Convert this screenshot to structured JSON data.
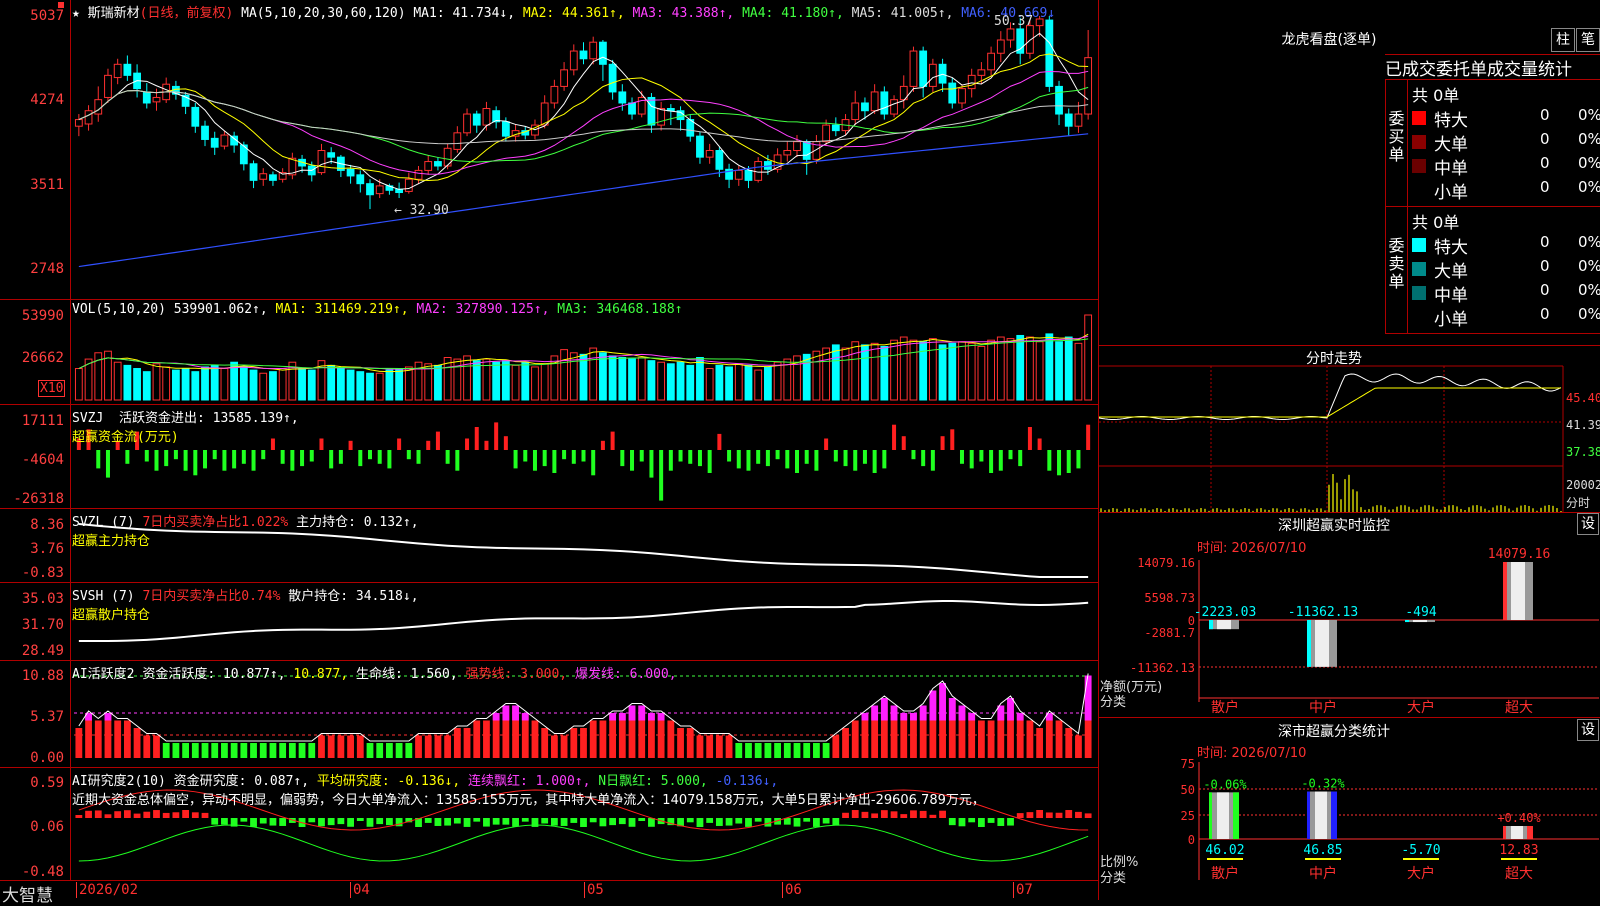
{
  "stock": {
    "name": "斯瑞新材",
    "period_label": "(日线，前复权)"
  },
  "kline": {
    "y_ticks": [
      "5037",
      "4274",
      "3511",
      "2748"
    ],
    "ma_legend": [
      {
        "text": "MA(5,10,20,30,60,120)",
        "color": "#ffffff"
      },
      {
        "text": "MA1: 41.734↓,",
        "color": "#ffffff"
      },
      {
        "text": "MA2: 44.361↑,",
        "color": "#ffff00"
      },
      {
        "text": "MA3: 43.388↑,",
        "color": "#ff40ff"
      },
      {
        "text": "MA4: 41.180↑,",
        "color": "#40ff40"
      },
      {
        "text": "MA5: 41.005↑,",
        "color": "#dddddd"
      },
      {
        "text": "MA6: 40.669↓",
        "color": "#4060ff"
      }
    ],
    "high_label": "50.37",
    "low_label": "32.90",
    "y_range": [
      2748,
      5037
    ],
    "candles": [
      [
        4040,
        4100,
        3950,
        4150
      ],
      [
        4060,
        4180,
        4000,
        4230
      ],
      [
        4150,
        4280,
        4080,
        4400
      ],
      [
        4300,
        4500,
        4250,
        4560
      ],
      [
        4480,
        4600,
        4420,
        4650
      ],
      [
        4600,
        4500,
        4450,
        4680
      ],
      [
        4520,
        4380,
        4300,
        4600
      ],
      [
        4350,
        4250,
        4200,
        4430
      ],
      [
        4260,
        4300,
        4180,
        4380
      ],
      [
        4280,
        4420,
        4250,
        4480
      ],
      [
        4400,
        4330,
        4280,
        4450
      ],
      [
        4320,
        4220,
        4150,
        4350
      ],
      [
        4210,
        4040,
        3980,
        4250
      ],
      [
        4040,
        3920,
        3860,
        4090
      ],
      [
        3930,
        3850,
        3780,
        3990
      ],
      [
        3860,
        3960,
        3830,
        4000
      ],
      [
        3950,
        3870,
        3800,
        3990
      ],
      [
        3870,
        3700,
        3640,
        3900
      ],
      [
        3700,
        3550,
        3480,
        3730
      ],
      [
        3560,
        3610,
        3500,
        3660
      ],
      [
        3600,
        3550,
        3500,
        3630
      ],
      [
        3560,
        3620,
        3530,
        3660
      ],
      [
        3600,
        3750,
        3560,
        3800
      ],
      [
        3740,
        3680,
        3620,
        3780
      ],
      [
        3680,
        3600,
        3540,
        3720
      ],
      [
        3620,
        3820,
        3600,
        3880
      ],
      [
        3800,
        3760,
        3700,
        3850
      ],
      [
        3760,
        3640,
        3580,
        3780
      ],
      [
        3650,
        3590,
        3520,
        3690
      ],
      [
        3600,
        3520,
        3440,
        3640
      ],
      [
        3520,
        3420,
        3290,
        3560
      ],
      [
        3430,
        3500,
        3390,
        3560
      ],
      [
        3500,
        3460,
        3420,
        3520
      ],
      [
        3470,
        3440,
        3390,
        3530
      ],
      [
        3450,
        3560,
        3430,
        3620
      ],
      [
        3560,
        3640,
        3520,
        3680
      ],
      [
        3640,
        3720,
        3600,
        3780
      ],
      [
        3720,
        3680,
        3640,
        3760
      ],
      [
        3680,
        3840,
        3650,
        3880
      ],
      [
        3830,
        3980,
        3800,
        4040
      ],
      [
        3980,
        4150,
        3950,
        4200
      ],
      [
        4150,
        4050,
        3980,
        4180
      ],
      [
        4050,
        4200,
        4000,
        4260
      ],
      [
        4180,
        4080,
        4020,
        4220
      ],
      [
        4080,
        3950,
        3900,
        4120
      ],
      [
        3950,
        4000,
        3900,
        4060
      ],
      [
        4000,
        3960,
        3920,
        4040
      ],
      [
        3960,
        4050,
        3920,
        4100
      ],
      [
        4050,
        4250,
        4020,
        4320
      ],
      [
        4250,
        4400,
        4200,
        4460
      ],
      [
        4400,
        4550,
        4360,
        4620
      ],
      [
        4550,
        4720,
        4500,
        4780
      ],
      [
        4720,
        4650,
        4600,
        4800
      ],
      [
        4650,
        4800,
        4600,
        4850
      ],
      [
        4800,
        4600,
        4450,
        4820
      ],
      [
        4600,
        4350,
        4280,
        4640
      ],
      [
        4350,
        4250,
        4180,
        4420
      ],
      [
        4250,
        4150,
        4100,
        4300
      ],
      [
        4150,
        4300,
        4120,
        4360
      ],
      [
        4300,
        4050,
        3980,
        4340
      ],
      [
        4050,
        4200,
        4000,
        4260
      ],
      [
        4200,
        4180,
        4050,
        4240
      ],
      [
        4180,
        4100,
        4000,
        4220
      ],
      [
        4100,
        3950,
        3900,
        4140
      ],
      [
        3950,
        3760,
        3700,
        3990
      ],
      [
        3760,
        3820,
        3700,
        3880
      ],
      [
        3820,
        3650,
        3580,
        3850
      ],
      [
        3650,
        3560,
        3480,
        3700
      ],
      [
        3560,
        3640,
        3500,
        3680
      ],
      [
        3640,
        3550,
        3480,
        3680
      ],
      [
        3550,
        3720,
        3530,
        3760
      ],
      [
        3720,
        3650,
        3600,
        3780
      ],
      [
        3650,
        3780,
        3620,
        3840
      ],
      [
        3780,
        3820,
        3720,
        3900
      ],
      [
        3820,
        3900,
        3760,
        3960
      ],
      [
        3900,
        3740,
        3600,
        3920
      ],
      [
        3740,
        3900,
        3700,
        3960
      ],
      [
        3900,
        4050,
        3860,
        4100
      ],
      [
        4050,
        4000,
        3950,
        4120
      ],
      [
        4000,
        4100,
        3960,
        4150
      ],
      [
        4100,
        4250,
        4050,
        4360
      ],
      [
        4250,
        4180,
        4100,
        4300
      ],
      [
        4180,
        4350,
        4150,
        4420
      ],
      [
        4350,
        4150,
        4100,
        4400
      ],
      [
        4150,
        4280,
        4120,
        4320
      ],
      [
        4280,
        4400,
        4200,
        4500
      ],
      [
        4400,
        4720,
        4350,
        4760
      ],
      [
        4720,
        4400,
        4300,
        4760
      ],
      [
        4400,
        4600,
        4350,
        4650
      ],
      [
        4600,
        4430,
        4350,
        4650
      ],
      [
        4430,
        4250,
        4200,
        4480
      ],
      [
        4250,
        4380,
        4200,
        4420
      ],
      [
        4380,
        4500,
        4300,
        4560
      ],
      [
        4500,
        4550,
        4420,
        4620
      ],
      [
        4550,
        4700,
        4500,
        4760
      ],
      [
        4700,
        4820,
        4620,
        4900
      ],
      [
        4820,
        4920,
        4750,
        4980
      ],
      [
        4920,
        4700,
        4600,
        5020
      ],
      [
        4700,
        4950,
        4650,
        5000
      ],
      [
        4950,
        5010,
        4850,
        5037
      ],
      [
        5000,
        4400,
        4350,
        5037
      ],
      [
        4400,
        4150,
        4050,
        4450
      ],
      [
        4150,
        4040,
        3950,
        4200
      ],
      [
        4040,
        4150,
        3980,
        4260
      ],
      [
        4150,
        4660,
        4100,
        4910
      ]
    ]
  },
  "volume": {
    "header": "VOL(5,10,20)",
    "items": [
      {
        "text": "539901.062↑,",
        "color": "#ffffff"
      },
      {
        "text": "MA1: 311469.219↑,",
        "color": "#ffff00"
      },
      {
        "text": "MA2: 327890.125↑,",
        "color": "#ff40ff"
      },
      {
        "text": "MA3: 346468.188↑",
        "color": "#40ff40"
      }
    ],
    "y_ticks": [
      "53990",
      "26662"
    ],
    "unit": "X10",
    "values": [
      20,
      26,
      30,
      31,
      24,
      22,
      20,
      18,
      23,
      21,
      19,
      20,
      18,
      21,
      22,
      20,
      24,
      21,
      19,
      17,
      18,
      20,
      24,
      20,
      19,
      25,
      22,
      20,
      19,
      18,
      17,
      17,
      19,
      20,
      21,
      24,
      23,
      22,
      27,
      26,
      28,
      25,
      26,
      24,
      25,
      22,
      24,
      21,
      23,
      28,
      32,
      30,
      29,
      33,
      30,
      28,
      27,
      26,
      27,
      25,
      24,
      23,
      24,
      22,
      27,
      20,
      22,
      21,
      23,
      22,
      19,
      21,
      24,
      26,
      28,
      29,
      31,
      33,
      35,
      33,
      37,
      35,
      36,
      34,
      38,
      40,
      38,
      37,
      39,
      35,
      36,
      37,
      36,
      34,
      38,
      40,
      39,
      41,
      40,
      37,
      42,
      37,
      40,
      36,
      54
    ]
  },
  "svzj": {
    "header": "SVZJ",
    "line1": "活跃资金进出: 13585.139↑,",
    "line2": "超赢资金流(万元)",
    "y_ticks": [
      "17111",
      "-4604",
      "-26318"
    ],
    "values": [
      5,
      9,
      -8,
      -12,
      4,
      -6,
      8,
      -5,
      -9,
      -7,
      -4,
      -9,
      -11,
      -8,
      -4,
      -9,
      -8,
      -6,
      -9,
      -4,
      5,
      -6,
      -9,
      -7,
      -5,
      5,
      -8,
      -6,
      4,
      -7,
      -4,
      -6,
      -8,
      5,
      -4,
      -6,
      4,
      8,
      -6,
      -9,
      5,
      10,
      4,
      12,
      6,
      -8,
      -5,
      -9,
      -7,
      -10,
      -4,
      -6,
      -5,
      -11,
      4,
      8,
      -7,
      -9,
      -5,
      -12,
      -22,
      -9,
      -5,
      -6,
      -7,
      -10,
      7,
      -5,
      -8,
      -9,
      -6,
      -7,
      -4,
      -8,
      -10,
      -6,
      -9,
      5,
      -5,
      -7,
      -9,
      -6,
      -10,
      -8,
      11,
      6,
      -4,
      -7,
      -9,
      6,
      9,
      -6,
      -8,
      -5,
      -10,
      -9,
      -4,
      -7,
      10,
      5,
      -9,
      -11,
      -10,
      -8,
      11
    ]
  },
  "svzl": {
    "header": "SVZL (7)",
    "text1": "7日内买卖净占比1.022%",
    "text2": "主力持仓: 0.132↑,",
    "line2": "超赢主力持仓",
    "y_ticks": [
      "8.36",
      "3.76",
      "-0.83"
    ]
  },
  "svsh": {
    "header": "SVSH (7)",
    "text1": "7日内买卖净占比0.74%",
    "text2": "散户持仓: 34.518↓,",
    "line2": "超赢散户持仓",
    "y_ticks": [
      "35.03",
      "31.70",
      "28.49"
    ]
  },
  "ai_active": {
    "header": "AI活跃度2",
    "items": [
      {
        "text": "资金活跃度: 10.877↑,",
        "color": "#ffffff"
      },
      {
        "text": "10.877,",
        "color": "#ffff00"
      },
      {
        "text": "生命线: 1.560,",
        "color": "#ffffff"
      },
      {
        "text": "强势线: 3.000,",
        "color": "#ff3030"
      },
      {
        "text": "爆发线: 6.000,",
        "color": "#ff40ff"
      }
    ],
    "y_ticks": [
      "10.88",
      "5.37",
      "0.00"
    ],
    "values": [
      4,
      6,
      5,
      6,
      5,
      5,
      4,
      3,
      3,
      2,
      2,
      2,
      2,
      2,
      2,
      2,
      2,
      2,
      2,
      2,
      2,
      2,
      2,
      2,
      2,
      3,
      3,
      3,
      3,
      3,
      2,
      2,
      2,
      2,
      2,
      3,
      3,
      3,
      3,
      4,
      4,
      5,
      5,
      6,
      7,
      7,
      6,
      5,
      4,
      3,
      3,
      4,
      4,
      5,
      5,
      6,
      6,
      7,
      7,
      6,
      6,
      5,
      4,
      4,
      3,
      3,
      3,
      3,
      2,
      2,
      2,
      2,
      2,
      2,
      2,
      2,
      2,
      2,
      3,
      4,
      5,
      6,
      7,
      8,
      7,
      6,
      6,
      7,
      9,
      10,
      8,
      7,
      6,
      5,
      5,
      7,
      8,
      6,
      5,
      4,
      6,
      5,
      4,
      3,
      11
    ]
  },
  "ai_research": {
    "header": "AI研究度2(10)",
    "items": [
      {
        "text": "资金研究度: 0.087↑,",
        "color": "#ffffff"
      },
      {
        "text": "平均研究度: -0.136↓,",
        "color": "#ffff00"
      },
      {
        "text": "连续飘红: 1.000↑,",
        "color": "#ff40ff"
      },
      {
        "text": "N日飘红: 5.000,",
        "color": "#40ff40"
      },
      {
        "text": "-0.136↓,",
        "color": "#4060ff"
      }
    ],
    "summary": "近期大资金总体偏空，异动不明显，偏弱势，今日大单净流入：13585.155万元，其中特大单净流入：14079.158万元，大单5日累计净出-29606.789万元，",
    "y_ticks": [
      "0.59",
      "0.06",
      "-0.48"
    ]
  },
  "x_axis": {
    "labels": [
      "2026/02",
      "04",
      "05",
      "06",
      "07"
    ]
  },
  "brand": "大智慧",
  "right_panel": {
    "title": "龙虎看盘(逐单)",
    "btn_col": "柱",
    "btn_pen": "笔",
    "tabs": [
      "已成交",
      "委托单",
      "成交量统计"
    ],
    "buy_label": "委买单",
    "sell_label": "委卖单",
    "buy_total": "共 0单",
    "sell_total": "共 0单",
    "buy_rows": [
      {
        "label": "特大",
        "count": "0",
        "pct": "0%",
        "color": "#ff0000"
      },
      {
        "label": "大单",
        "count": "0",
        "pct": "0%",
        "color": "#8b0000"
      },
      {
        "label": "中单",
        "count": "0",
        "pct": "0%",
        "color": "#6a0000"
      },
      {
        "label": "小单",
        "count": "0",
        "pct": "0%",
        "color": "#000000"
      }
    ],
    "sell_rows": [
      {
        "label": "特大",
        "count": "0",
        "pct": "0%",
        "color": "#00ffff"
      },
      {
        "label": "大单",
        "count": "0",
        "pct": "0%",
        "color": "#008b8b"
      },
      {
        "label": "中单",
        "count": "0",
        "pct": "0%",
        "color": "#007070"
      },
      {
        "label": "小单",
        "count": "0",
        "pct": "0%",
        "color": "#000000"
      }
    ],
    "intraday_title": "分时走势",
    "intraday_y": [
      "45.40",
      "41.39",
      "37.38"
    ],
    "intraday_vol_label": "20002",
    "intraday_vol_unit": "分时",
    "monitor_title": "深圳超赢实时监控",
    "monitor_btn": "设",
    "monitor_date": "时间: 2026/07/10",
    "monitor_y": [
      "14079.16",
      "5598.73",
      "0",
      "-2881.7",
      "-11362.13"
    ],
    "monitor_vals": [
      "-2223.03",
      "-11362.13",
      "-494",
      "14079.16"
    ],
    "monitor_unit": "净额(万元)",
    "monitor_unit2": "分类",
    "stats_title": "深市超赢分类统计",
    "stats_btn": "设",
    "stats_date": "时间: 2026/07/10",
    "stats_y": [
      "75",
      "50",
      "25",
      "0"
    ],
    "stats_pct": [
      "-0.06%",
      "-0.32%",
      "",
      "+0.40%"
    ],
    "stats_vals": [
      "46.02",
      "46.85",
      "-5.70",
      "12.83"
    ],
    "stats_unit": "比例%",
    "stats_unit2": "分类",
    "categories": [
      "散户",
      "中户",
      "大户",
      "超大"
    ]
  }
}
